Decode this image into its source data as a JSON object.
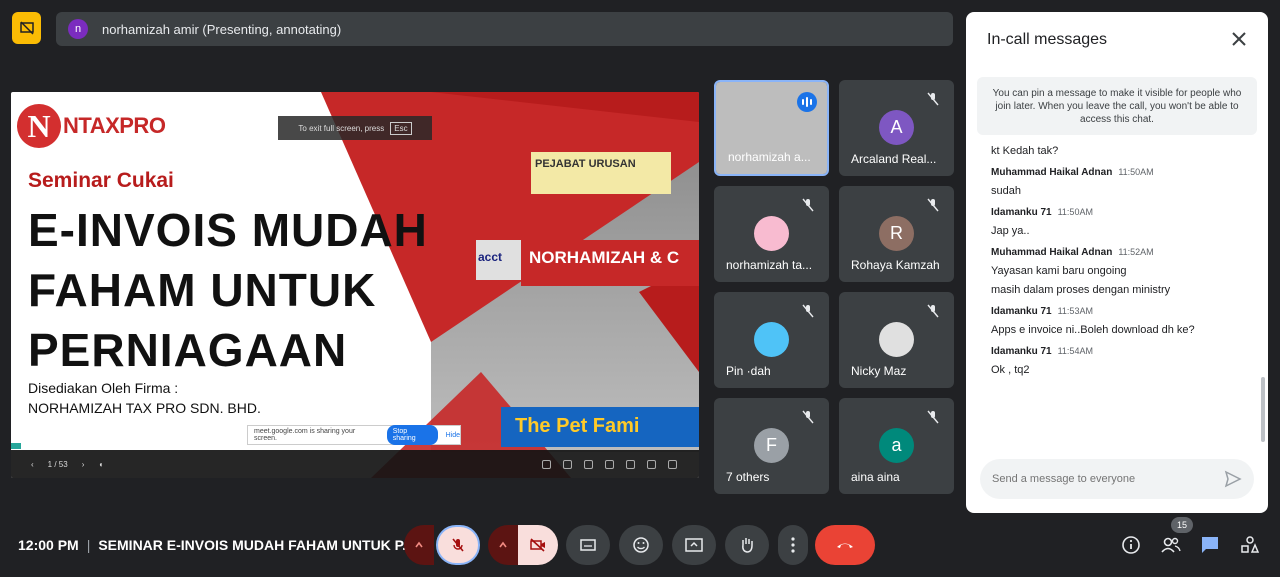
{
  "presenter_bar": {
    "avatar_initial": "n",
    "text": "norhamizah amir (Presenting, annotating)"
  },
  "slide": {
    "logo_letter": "N",
    "logo_text": "NTAXPRO",
    "subtitle": "Seminar Cukai",
    "title_line1": "E-INVOIS MUDAH",
    "title_line2": "FAHAM UNTUK",
    "title_line3": "PERNIAGAAN",
    "by_line1": "Disediakan Oleh Firma :",
    "by_line2": "NORHAMIZAH TAX PRO SDN. BHD.",
    "building_sign": "NORHAMIZAH & C",
    "acct_sign": "acct",
    "upper_sign": "PEJABAT URUSAN",
    "pet_shop": "The Pet Fami",
    "exit_hint": "To exit full screen, press",
    "exit_key": "Esc",
    "share_text": "meet.google.com is sharing your screen.",
    "stop_sharing": "Stop sharing",
    "hide": "Hide",
    "page_indicator": "1 / 53"
  },
  "tiles": [
    {
      "name": "norhamizah a...",
      "initial": "",
      "avatar_color": "#bdbdbd",
      "speaking": true
    },
    {
      "name": "Arcaland Real...",
      "initial": "A",
      "avatar_color": "#7e57c2",
      "speaking": false
    },
    {
      "name": "norhamizah ta...",
      "initial": "",
      "avatar_color": "#f8bbd0",
      "speaking": false
    },
    {
      "name": "Rohaya Kamzah",
      "initial": "R",
      "avatar_color": "#8d6e63",
      "speaking": false
    },
    {
      "name": "Pin ·dah",
      "initial": "",
      "avatar_color": "#4fc3f7",
      "speaking": false
    },
    {
      "name": "Nicky Maz",
      "initial": "",
      "avatar_color": "#e0e0e0",
      "speaking": false
    },
    {
      "name": "7 others",
      "initial": "F",
      "avatar_color": "#9aa0a6",
      "speaking": false
    },
    {
      "name": "aina aina",
      "initial": "a",
      "avatar_color": "#00897b",
      "speaking": false
    }
  ],
  "chat": {
    "title": "In-call messages",
    "info": "You can pin a message to make it visible for people who join later. When you leave the call, you won't be able to access this chat.",
    "top_fragment": "kt Kedah tak?",
    "messages": [
      {
        "sender": "Muhammad Haikal Adnan",
        "time": "11:50AM",
        "lines": [
          "sudah"
        ]
      },
      {
        "sender": "Idamanku 71",
        "time": "11:50AM",
        "lines": [
          "Jap ya.."
        ]
      },
      {
        "sender": "Muhammad Haikal Adnan",
        "time": "11:52AM",
        "lines": [
          "Yayasan kami baru ongoing",
          "masih dalam proses dengan ministry"
        ]
      },
      {
        "sender": "Idamanku 71",
        "time": "11:53AM",
        "lines": [
          "Apps e invoice  ni..Boleh download dh ke?"
        ]
      },
      {
        "sender": "Idamanku 71",
        "time": "11:54AM",
        "lines": [
          "Ok , tq2"
        ]
      }
    ],
    "input_placeholder": "Send a message to everyone"
  },
  "bottom": {
    "time": "12:00 PM",
    "separator": "|",
    "meeting_title": "SEMINAR E-INVOIS MUDAH FAHAM UNTUK P...",
    "participant_count": "15"
  },
  "colors": {
    "end_call": "#ea4335",
    "muted_bg": "#f9dedc",
    "accent": "#8ab4f8"
  }
}
